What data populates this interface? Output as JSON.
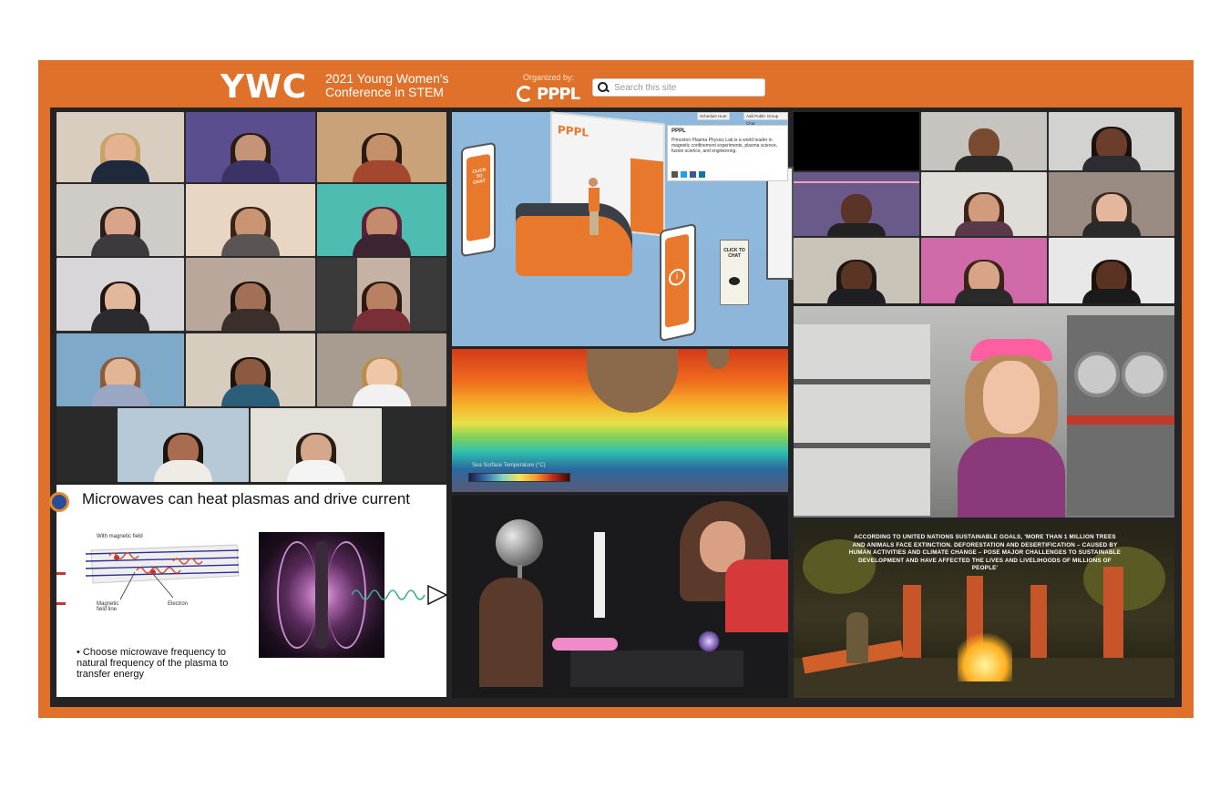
{
  "header": {
    "logo": "YWC",
    "conference_line1": "2021 Young Women's",
    "conference_line2": "Conference in STEM",
    "organized_by": "Organized by:",
    "organizer_logo": "PPPL",
    "search_placeholder": "Search this site"
  },
  "colors": {
    "frame": "#e0712a",
    "inner_bg": "#242424",
    "accent_orange": "#e8782c"
  },
  "slide": {
    "title": "Microwaves can heat plasmas and drive current",
    "label_magnetic": "With magnetic field",
    "label_field_line": "Magnetic field line",
    "label_electron": "Electron",
    "bullet": "Choose microwave frequency to natural frequency of the plasma to transfer energy"
  },
  "booth": {
    "btn_schedule": "Schedule Hunt",
    "btn_group_chat": "Add Public Group Chat",
    "info_title": "PPPL",
    "info_text": "Princeton Plasma Physics Lab is a world leader in magnetic confinement experiments, plasma science, fusion science, and engineering.",
    "sign_chat": "CLICK TO CHAT",
    "booth_logo": "PPPL"
  },
  "heatmap": {
    "colorbar_label": "Sea Surface Temperature (°C)"
  },
  "vr_scene": {
    "caption": "ACCORDING TO UNITED NATIONS SUSTAINABLE GOALS, 'MORE THAN 1 MILLION TREES AND ANIMALS FACE EXTINCTION. DEFORESTATION AND DESERTIFICATION – CAUSED BY HUMAN ACTIVITIES AND CLIMATE CHANGE – POSE MAJOR CHALLENGES TO SUSTAINABLE DEVELOPMENT AND HAVE AFFECTED THE LIVES AND LIVELIHOODS OF MILLIONS OF PEOPLE'"
  }
}
